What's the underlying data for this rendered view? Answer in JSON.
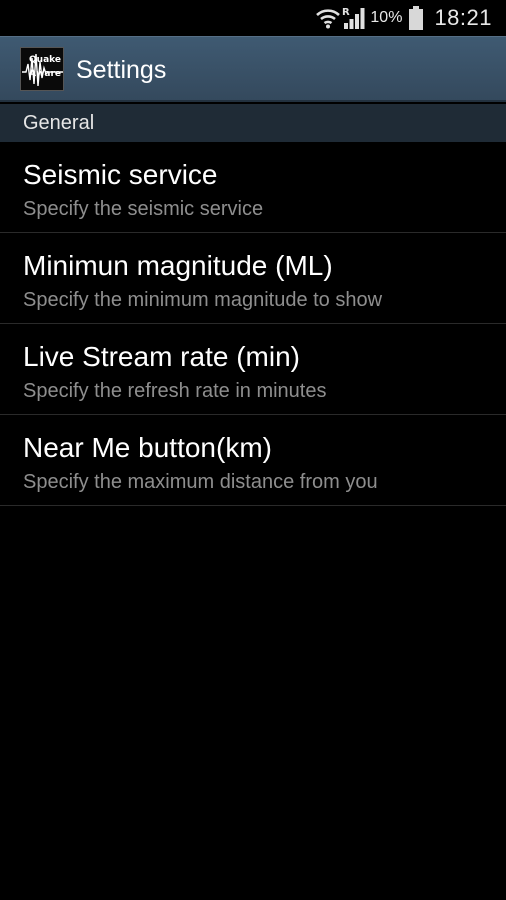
{
  "status_bar": {
    "wifi_icon": "wifi-icon",
    "roaming_indicator": "R",
    "signal_icon": "signal-icon",
    "battery_percent": "10%",
    "battery_icon": "battery-icon",
    "time": "18:21"
  },
  "action_bar": {
    "app_icon": "quake-aware-logo",
    "logo_text_line1": "Quake",
    "logo_text_line2": "Aware",
    "title": "Settings",
    "background_color": "#3b5369"
  },
  "section": {
    "header": "General",
    "background_color": "#1f2b36"
  },
  "preferences": [
    {
      "title": "Seismic service",
      "summary": "Specify the seismic service"
    },
    {
      "title": "Minimun magnitude (ML)",
      "summary": "Specify the minimum magnitude to show"
    },
    {
      "title": "Live Stream rate (min)",
      "summary": "Specify the refresh rate in minutes"
    },
    {
      "title": "Near Me button(km)",
      "summary": "Specify the maximum distance from you"
    }
  ]
}
